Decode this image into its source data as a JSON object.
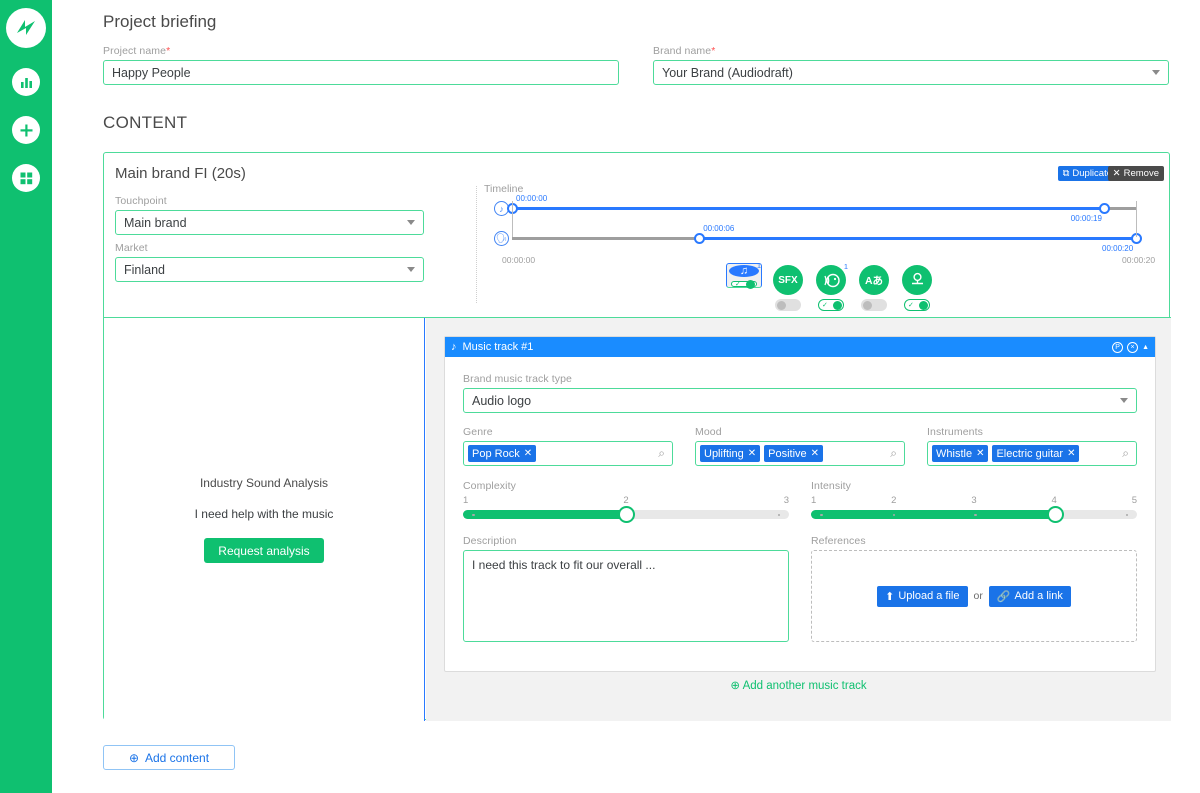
{
  "sidebar": {
    "logo_icon": "audiodraft-bolt-logo",
    "items": [
      {
        "icon": "bar-chart-icon",
        "name": "analytics"
      },
      {
        "icon": "plus-icon",
        "name": "create"
      },
      {
        "icon": "grid-icon",
        "name": "dashboard"
      }
    ]
  },
  "header": {
    "title": "Project briefing"
  },
  "project": {
    "name_label": "Project name",
    "name_value": "Happy People",
    "name_placeholder": "Project name",
    "brand_label": "Brand name",
    "brand_value": "Your Brand (Audiodraft)",
    "required_marker": "*"
  },
  "content_section": {
    "title": "CONTENT"
  },
  "content_card": {
    "title": "Main brand FI (20s)",
    "duplicate_label": "Duplicate",
    "duplicate_icon": "copy-icon",
    "remove_label": "Remove",
    "remove_icon": "close-icon",
    "touchpoint_label": "Touchpoint",
    "touchpoint_value": "Main brand",
    "market_label": "Market",
    "market_value": "Finland"
  },
  "timeline": {
    "label": "Timeline",
    "start_time": "00:00:00",
    "end_time": "00:00:20",
    "rows": [
      {
        "icon": "music-note-icon",
        "start_time": "00:00:00",
        "end_time": "00:00:19",
        "start_pct": 0,
        "end_pct": 95
      },
      {
        "icon": "voice-over-icon",
        "start_time": "00:00:06",
        "end_time": "00:00:20",
        "start_pct": 30,
        "end_pct": 100
      }
    ]
  },
  "track_tabs": [
    {
      "name": "music",
      "icon": "music-note-icon",
      "glyph": "♫",
      "badge": "1",
      "selected": true,
      "toggle_on": true
    },
    {
      "name": "sfx",
      "icon": "sfx-icon",
      "glyph": "SFX",
      "badge": "",
      "selected": false,
      "toggle_on": false
    },
    {
      "name": "voice-over",
      "icon": "voice-over-icon",
      "glyph": "",
      "badge": "1",
      "selected": false,
      "toggle_on": true
    },
    {
      "name": "translation",
      "icon": "translation-icon",
      "glyph": "Aあ",
      "badge": "",
      "selected": false,
      "toggle_on": false
    },
    {
      "name": "mastering",
      "icon": "mastering-icon",
      "glyph": "",
      "badge": "",
      "selected": false,
      "toggle_on": true
    }
  ],
  "analysis_panel": {
    "title": "Industry Sound Analysis",
    "subtitle": "I need help with the music",
    "button_label": "Request analysis"
  },
  "music_track": {
    "header_icon": "music-note-icon",
    "header_title": "Music track #1",
    "header_actions": [
      {
        "name": "duplicate-track-icon",
        "glyph": "Ⓟ"
      },
      {
        "name": "close-track-icon",
        "glyph": "×"
      },
      {
        "name": "collapse-track-icon",
        "glyph": "▲"
      }
    ],
    "type_label": "Brand music track type",
    "type_value": "Audio logo",
    "genre_label": "Genre",
    "genre_tags": [
      "Pop Rock"
    ],
    "mood_label": "Mood",
    "mood_tags": [
      "Uplifting",
      "Positive"
    ],
    "instruments_label": "Instruments",
    "instruments_tags": [
      "Whistle",
      "Electric guitar"
    ],
    "search_icon": "search-icon",
    "complexity": {
      "label": "Complexity",
      "ticks": [
        "1",
        "2",
        "3"
      ],
      "min": 1,
      "max": 3,
      "value": 2
    },
    "intensity": {
      "label": "Intensity",
      "ticks": [
        "1",
        "2",
        "3",
        "4",
        "5"
      ],
      "min": 1,
      "max": 5,
      "value": 4
    },
    "description_label": "Description",
    "description_value": "I need this track to fit our overall ...",
    "references_label": "References",
    "upload_label": "Upload a file",
    "upload_icon": "upload-icon",
    "or_label": "or",
    "link_label": "Add a link",
    "link_icon": "link-icon"
  },
  "add_track": {
    "label": "Add another music track",
    "icon": "plus-circle-icon"
  },
  "add_content": {
    "label": "Add content",
    "icon": "plus-circle-icon"
  },
  "colors": {
    "brand_green": "#0fc070",
    "field_green": "#4ddb9a",
    "blue": "#1a73e8",
    "track_blue": "#2979ff",
    "dark": "#4a4a4a",
    "muted": "#9e9e9e"
  }
}
